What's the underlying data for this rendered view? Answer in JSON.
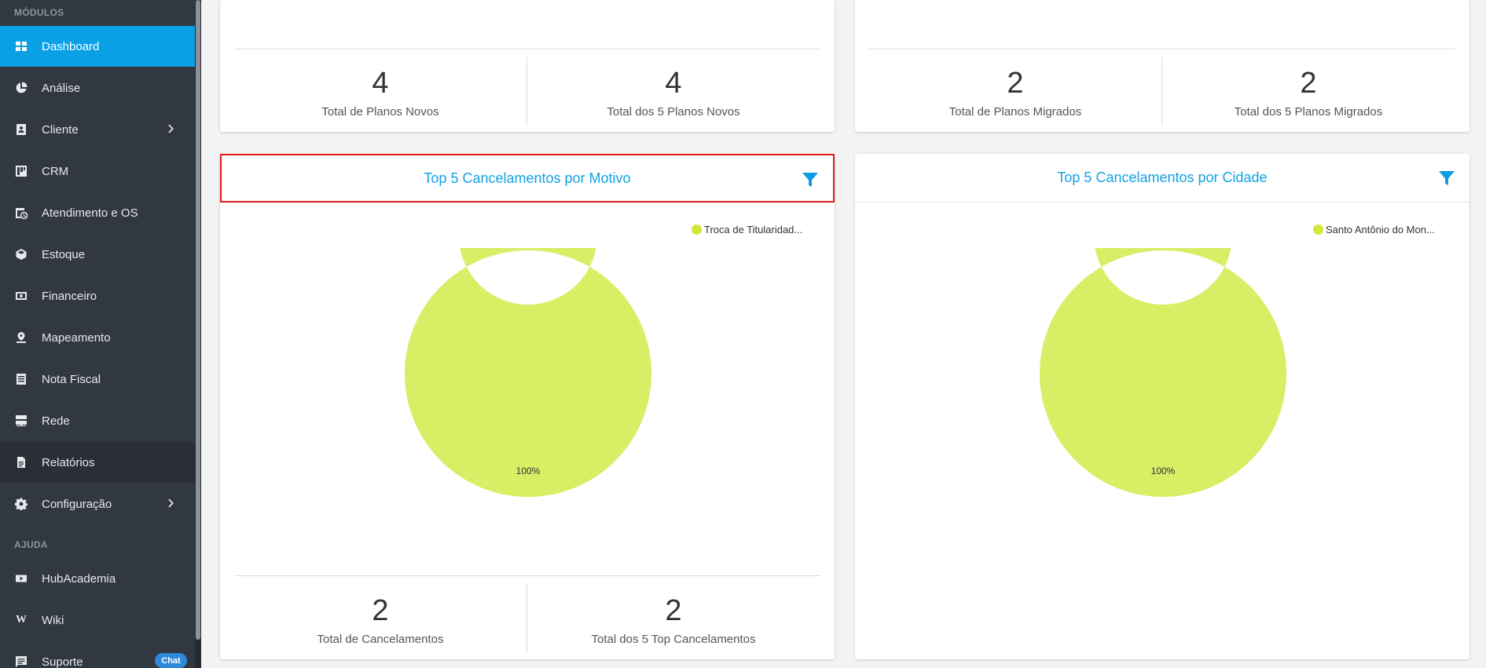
{
  "sidebar": {
    "sections": {
      "modules": "MÓDULOS",
      "help": "AJUDA"
    },
    "items": [
      {
        "label": "Dashboard",
        "icon": "dashboard-icon"
      },
      {
        "label": "Análise",
        "icon": "pie-chart-icon"
      },
      {
        "label": "Cliente",
        "icon": "contact-card-icon"
      },
      {
        "label": "CRM",
        "icon": "kanban-board-icon"
      },
      {
        "label": "Atendimento e OS",
        "icon": "calendar-clock-icon"
      },
      {
        "label": "Estoque",
        "icon": "box-icon"
      },
      {
        "label": "Financeiro",
        "icon": "money-icon"
      },
      {
        "label": "Mapeamento",
        "icon": "map-pin-icon"
      },
      {
        "label": "Nota Fiscal",
        "icon": "receipt-icon"
      },
      {
        "label": "Rede",
        "icon": "server-icon"
      },
      {
        "label": "Relatórios",
        "icon": "document-icon"
      },
      {
        "label": "Configuração",
        "icon": "gear-icon"
      }
    ],
    "help_items": [
      {
        "label": "HubAcademia",
        "icon": "youtube-icon"
      },
      {
        "label": "Wiki",
        "icon": "wikipedia-icon"
      },
      {
        "label": "Suporte",
        "icon": "chat-bubble-icon",
        "badge": "Chat"
      }
    ],
    "active_color": "#0aa0e6"
  },
  "cards": {
    "planos_novos": {
      "stat1": {
        "value": "4",
        "label": "Total de Planos Novos"
      },
      "stat2": {
        "value": "4",
        "label": "Total dos 5 Planos Novos"
      }
    },
    "planos_migrados": {
      "stat1": {
        "value": "2",
        "label": "Total de Planos Migrados"
      },
      "stat2": {
        "value": "2",
        "label": "Total dos 5 Planos Migrados"
      }
    },
    "cancel_motivo": {
      "title": "Top 5 Cancelamentos por Motivo",
      "legend": "Troca de Titularidad...",
      "pct": "100%",
      "stat1": {
        "value": "2",
        "label": "Total de Cancelamentos"
      },
      "stat2": {
        "value": "2",
        "label": "Total dos 5 Top Cancelamentos"
      }
    },
    "cancel_cidade": {
      "title": "Top 5 Cancelamentos por Cidade",
      "legend": "Santo Antônio do Mon...",
      "pct": "100%"
    }
  },
  "chart_data": [
    {
      "type": "pie",
      "title": "Top 5 Cancelamentos por Motivo",
      "categories": [
        "Troca de Titularidad..."
      ],
      "values": [
        100
      ],
      "color": "#d9ed65"
    },
    {
      "type": "pie",
      "title": "Top 5 Cancelamentos por Cidade",
      "categories": [
        "Santo Antônio do Mon..."
      ],
      "values": [
        100
      ],
      "color": "#d9ed65"
    }
  ]
}
